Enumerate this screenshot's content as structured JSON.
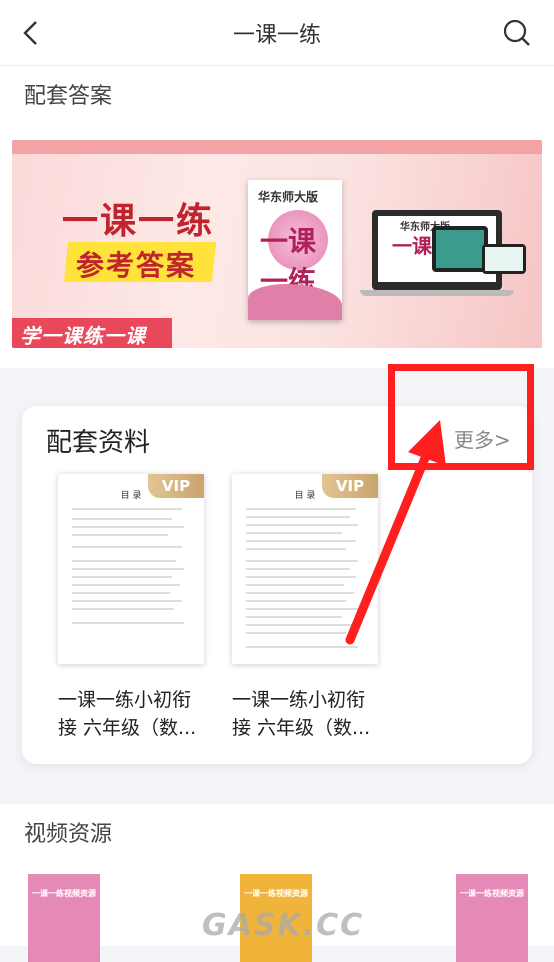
{
  "header": {
    "title": "一课一练"
  },
  "answers_section": {
    "title": "配套答案"
  },
  "banner": {
    "headline": "一课一练",
    "sub_headline": "参考答案",
    "slogan": "学一课练一课",
    "book_publisher": "华东师大版",
    "book_title": "一课一练",
    "monitor_publisher": "华东师大版",
    "monitor_title": "一课一练"
  },
  "materials": {
    "title": "配套资料",
    "more_label": "更多>",
    "items": [
      {
        "title": "一课一练小初衔接 六年级（数...",
        "badge": "VIP",
        "cover_heading": "目 录"
      },
      {
        "title": "一课一练小初衔接 六年级（数...",
        "badge": "VIP",
        "cover_heading": "目 录"
      }
    ]
  },
  "video_section": {
    "title": "视频资源",
    "items": [
      {
        "label": "一课一练视频资源",
        "color": "#e58ab6"
      },
      {
        "label": "一课一练视频资源",
        "color": "#f0b43a"
      },
      {
        "label": "一课一练视频资源",
        "color": "#e58ab6"
      }
    ]
  },
  "watermark": "GASK.CC",
  "colors": {
    "accent_red": "#ff1f1f",
    "vip_gold": "#d3b07b",
    "brand_pink": "#c0242e"
  }
}
